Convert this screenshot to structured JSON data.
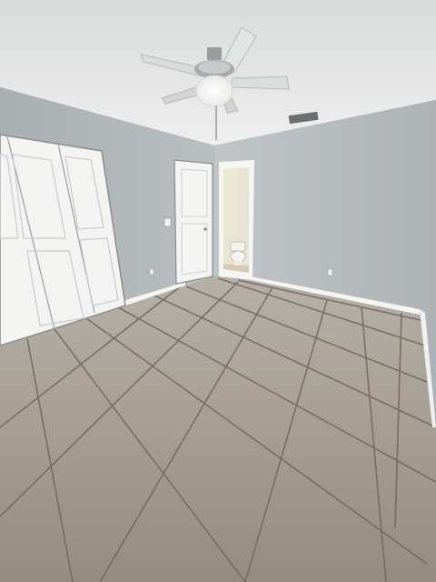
{
  "scene": {
    "room": "empty bedroom",
    "ceiling_color": "#e6e7e6",
    "wall_color": "#b7bcbf",
    "floor_color": "#a79f94",
    "grout_color": "#6f665c",
    "door_color": "#f4f4f2",
    "baseboard_color": "#f5f5f3",
    "objects": [
      "ceiling-fan",
      "ceiling-light",
      "air-vent",
      "bifold-closet-door",
      "interior-door",
      "bathroom-doorway",
      "toilet",
      "light-switch",
      "wall-outlet",
      "baseboard",
      "tile-floor"
    ]
  }
}
